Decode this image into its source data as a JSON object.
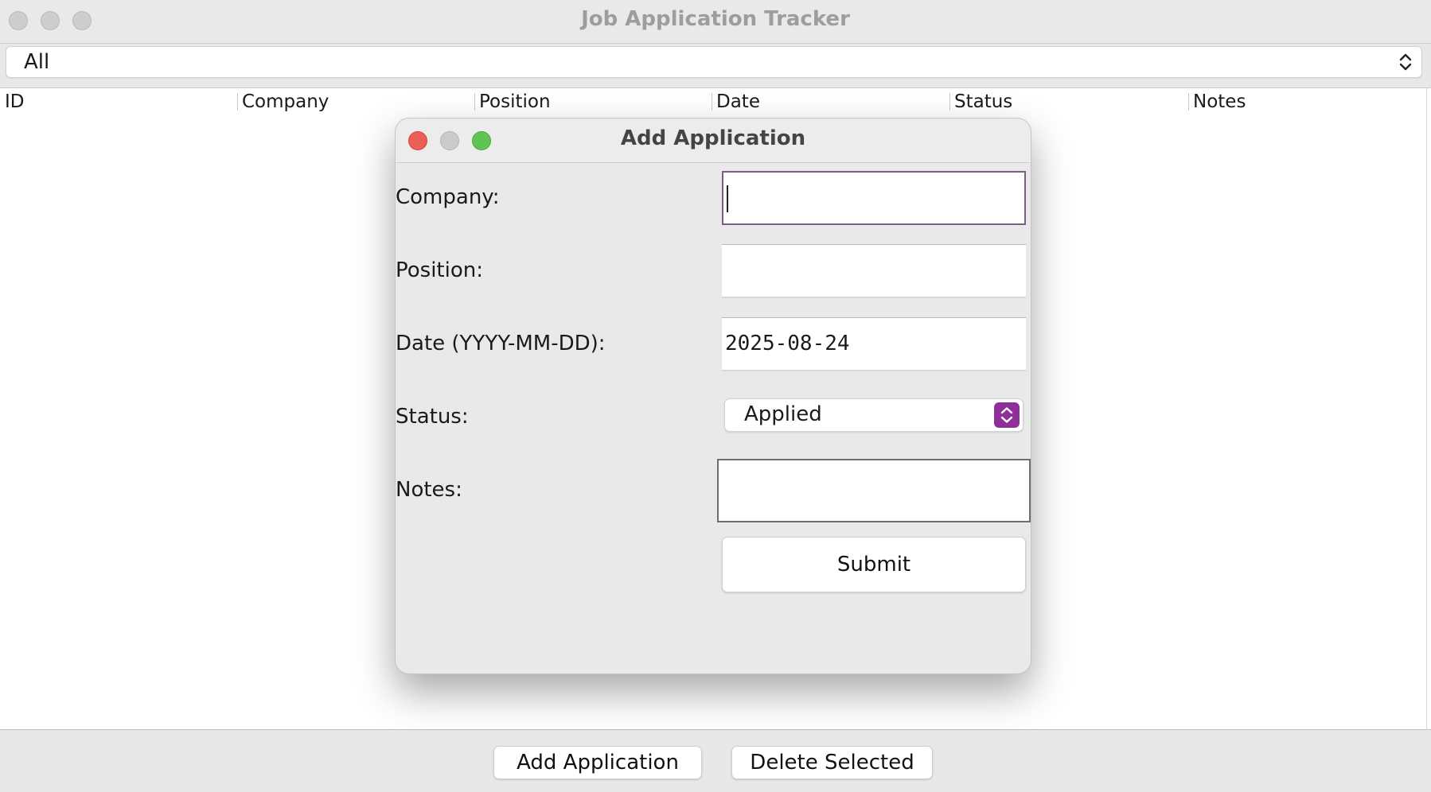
{
  "window": {
    "title": "Job Application Tracker"
  },
  "filter": {
    "selected": "All"
  },
  "table": {
    "columns": [
      "ID",
      "Company",
      "Position",
      "Date",
      "Status",
      "Notes"
    ],
    "rows": []
  },
  "actions": {
    "add_label": "Add Application",
    "delete_label": "Delete Selected"
  },
  "dialog": {
    "title": "Add Application",
    "company_label": "Company:",
    "company_value": "",
    "position_label": "Position:",
    "position_value": "",
    "date_label": "Date (YYYY-MM-DD):",
    "date_value": "2025-08-24",
    "status_label": "Status:",
    "status_value": "Applied",
    "notes_label": "Notes:",
    "notes_value": "",
    "submit_label": "Submit"
  },
  "colors": {
    "close": "#ec5f57",
    "minimize": "#c9c9c9",
    "zoom": "#5fc454",
    "accent": "#8e2f9a"
  },
  "icons": [
    "window-close-icon",
    "window-minimize-icon",
    "window-zoom-icon",
    "updown-chevron-icon"
  ]
}
